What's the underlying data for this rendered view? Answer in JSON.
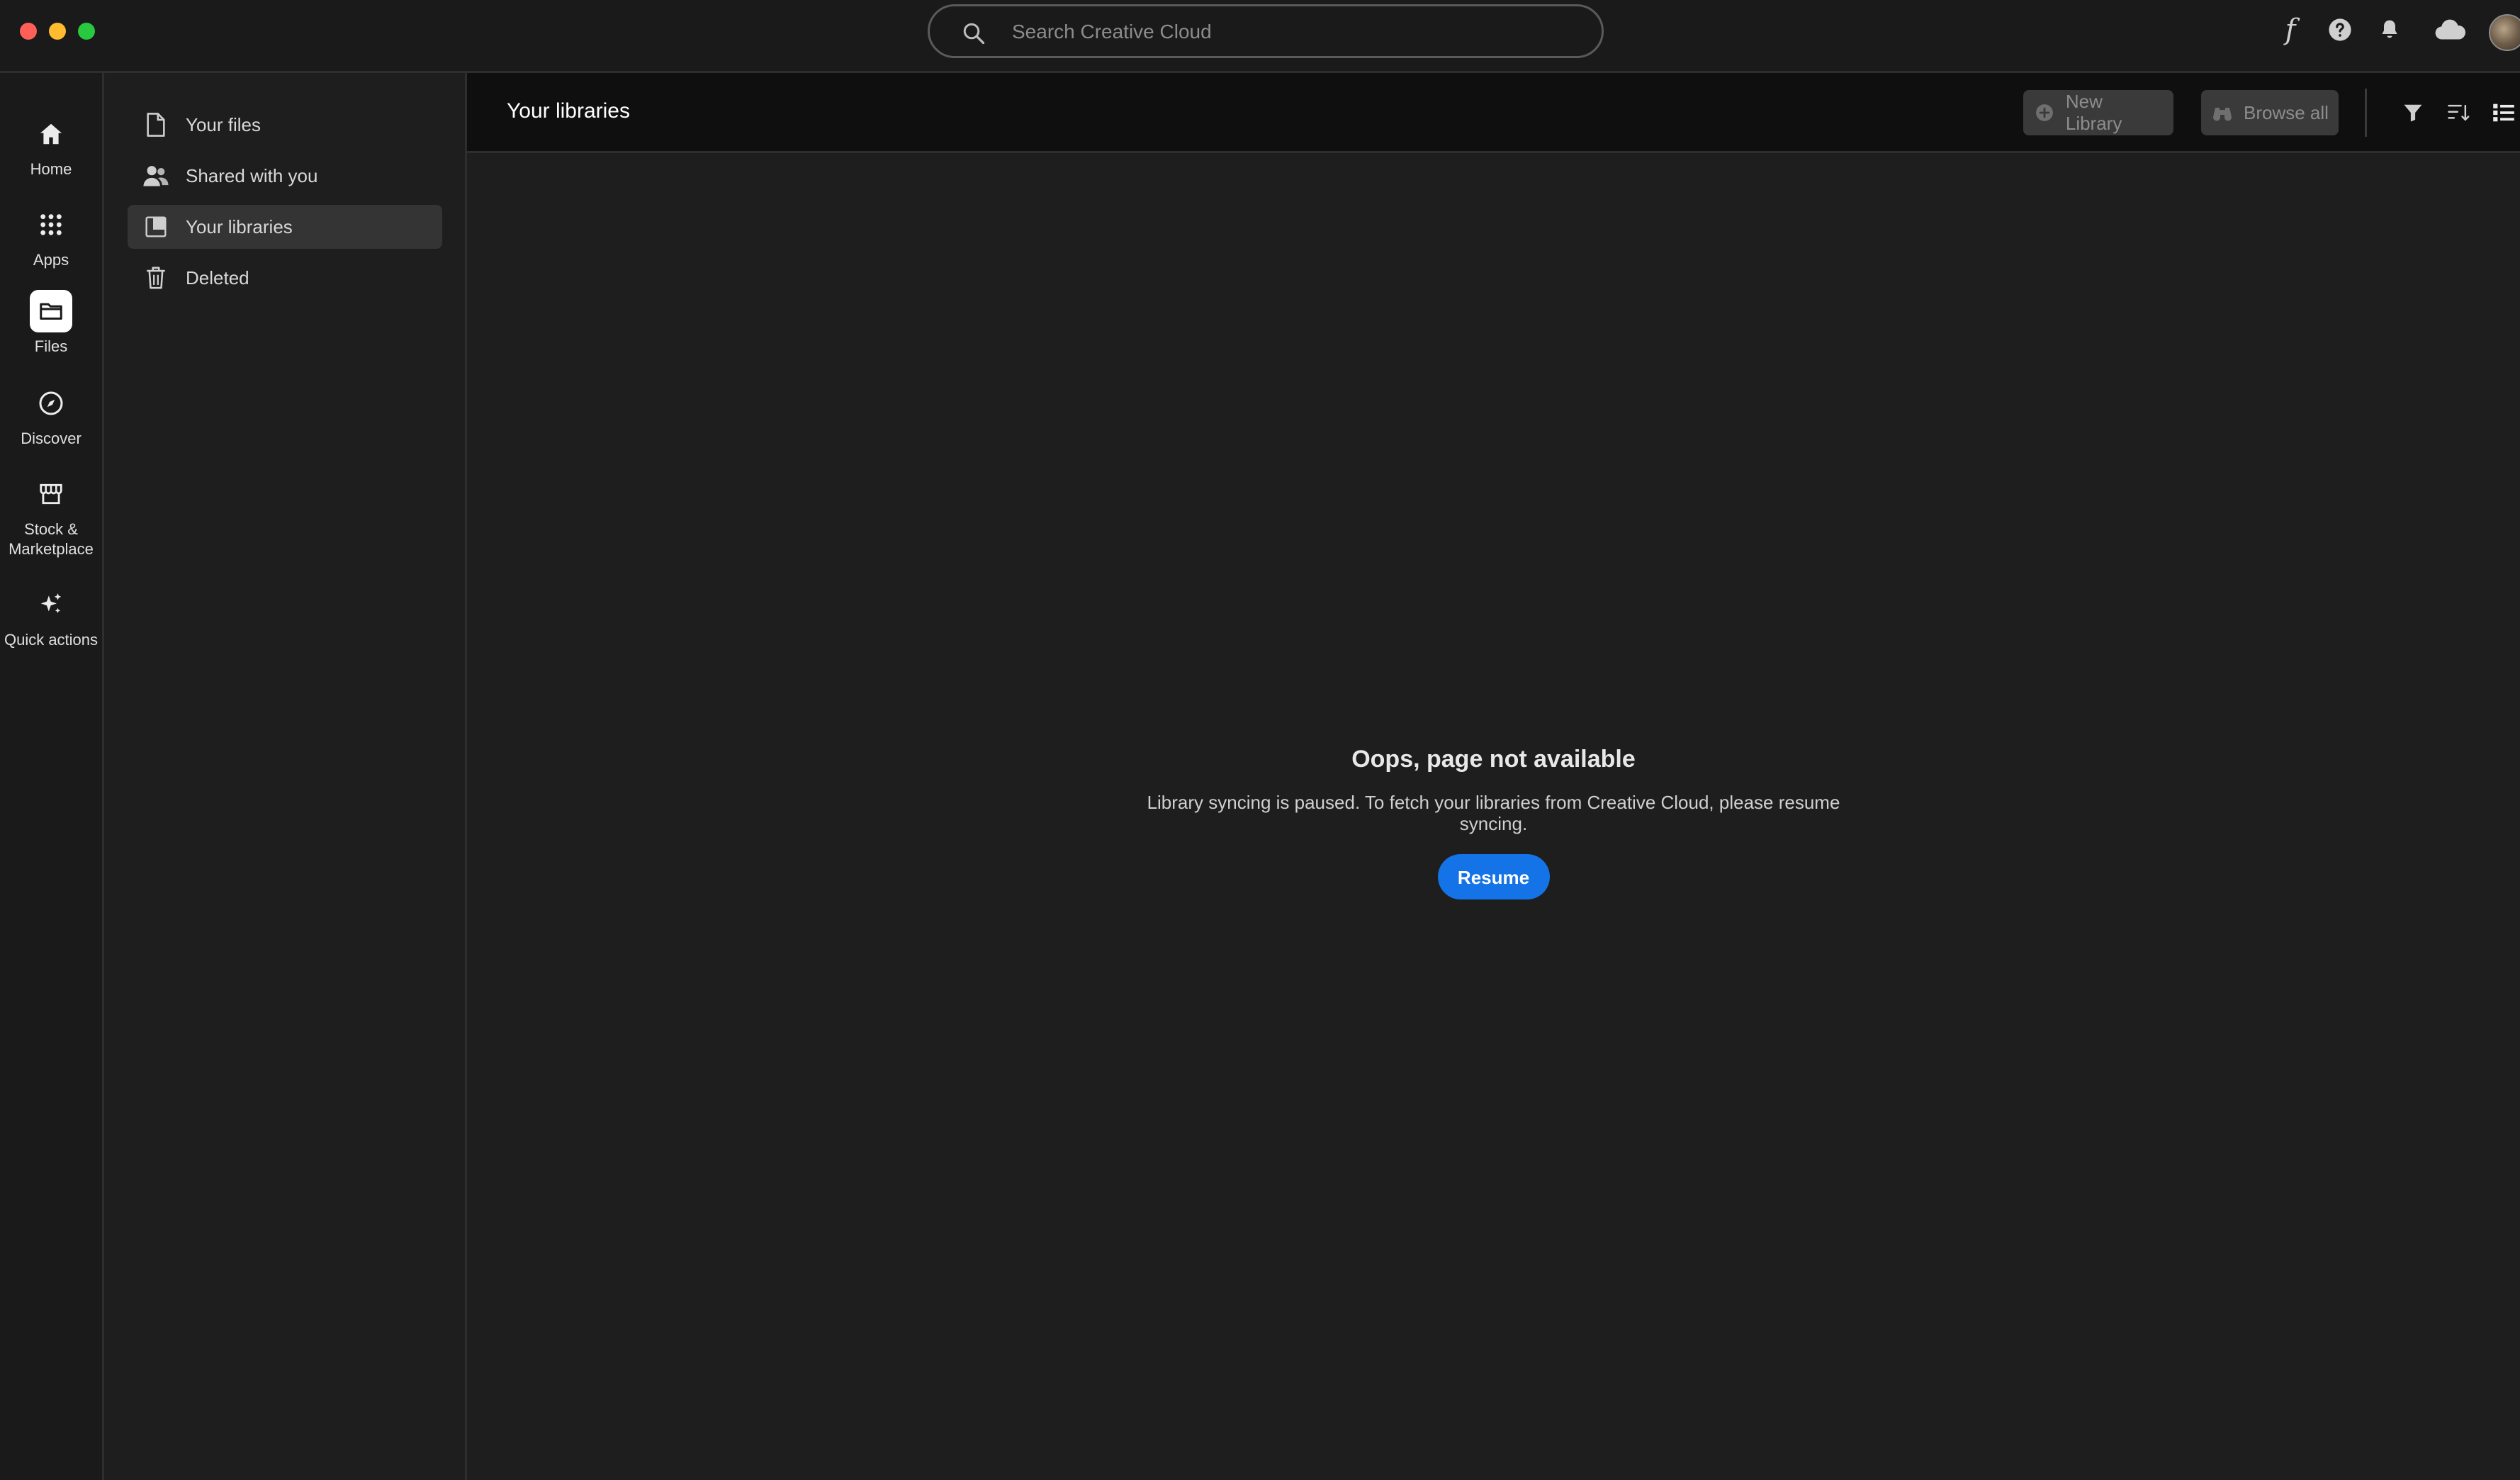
{
  "window": {
    "traffic_lights": [
      "close",
      "minimize",
      "maximize"
    ]
  },
  "search": {
    "placeholder": "Search Creative Cloud"
  },
  "topbar_icons": [
    "fonts-icon",
    "help-icon",
    "bell-icon",
    "cloud-icon",
    "avatar"
  ],
  "rail": {
    "items": [
      {
        "label": "Home",
        "icon": "home-icon"
      },
      {
        "label": "Apps",
        "icon": "apps-grid-icon"
      },
      {
        "label": "Files",
        "icon": "folder-icon",
        "active": true
      },
      {
        "label": "Discover",
        "icon": "compass-icon"
      },
      {
        "label": "Stock & Marketplace",
        "icon": "storefront-icon"
      },
      {
        "label": "Quick actions",
        "icon": "sparkle-icon"
      }
    ]
  },
  "sidebar": {
    "items": [
      {
        "label": "Your files",
        "icon": "file-icon"
      },
      {
        "label": "Shared with you",
        "icon": "users-icon"
      },
      {
        "label": "Your libraries",
        "icon": "library-icon",
        "active": true
      },
      {
        "label": "Deleted",
        "icon": "trash-icon"
      }
    ]
  },
  "main": {
    "title": "Your libraries",
    "new_library_label": "New Library",
    "browse_all_label": "Browse all",
    "view_icons": [
      "filter-icon",
      "sort-icon",
      "list-view-icon"
    ]
  },
  "empty_state": {
    "title": "Oops, page not available",
    "message": "Library syncing is paused. To fetch your libraries from Creative Cloud, please resume syncing.",
    "button_label": "Resume"
  },
  "colors": {
    "accent": "#1473e6",
    "background": "#1e1e1e",
    "titlebar": "#1a1a1a",
    "header": "#0f0f0f"
  }
}
